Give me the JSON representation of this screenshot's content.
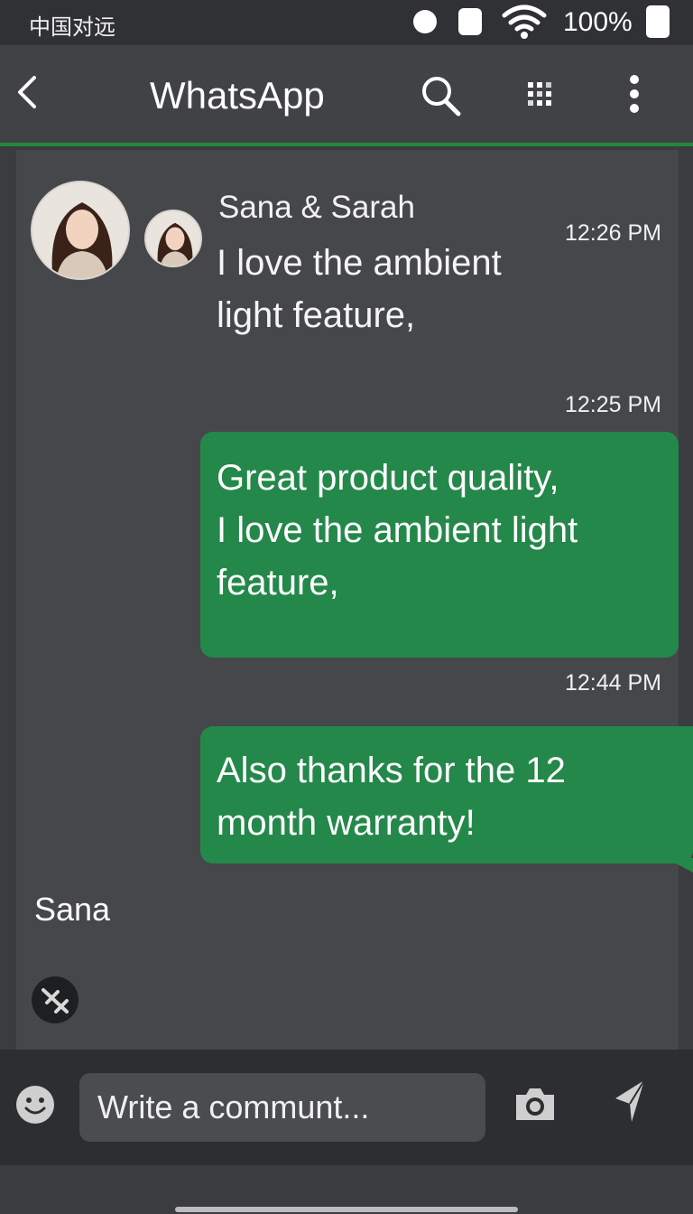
{
  "status_bar": {
    "carrier": "中国对远",
    "battery": "100%"
  },
  "header": {
    "title": "WhatsApp"
  },
  "chat": {
    "sender": "Sana & Sarah",
    "incoming": {
      "line1": "I love the ambient",
      "line2": "light feature,",
      "time": "12:26 PM"
    },
    "outgoing": [
      {
        "time": "12:25 PM",
        "line1": "Great product quality,",
        "line2": "I love the ambient light",
        "line3": "feature,"
      },
      {
        "time": "12:44 PM",
        "line1": "Also thanks for the 12",
        "line2": "month warranty!"
      }
    ],
    "footer_name": "Sana"
  },
  "input": {
    "placeholder": "Write a communt..."
  },
  "colors": {
    "accent": "#1f8a3e",
    "bubble": "#24884a",
    "background": "#45474b"
  },
  "icons": [
    "back-icon",
    "search-icon",
    "grid-icon",
    "more-icon",
    "mute-icon",
    "emoji-icon",
    "camera-icon",
    "send-icon",
    "wifi-icon"
  ]
}
